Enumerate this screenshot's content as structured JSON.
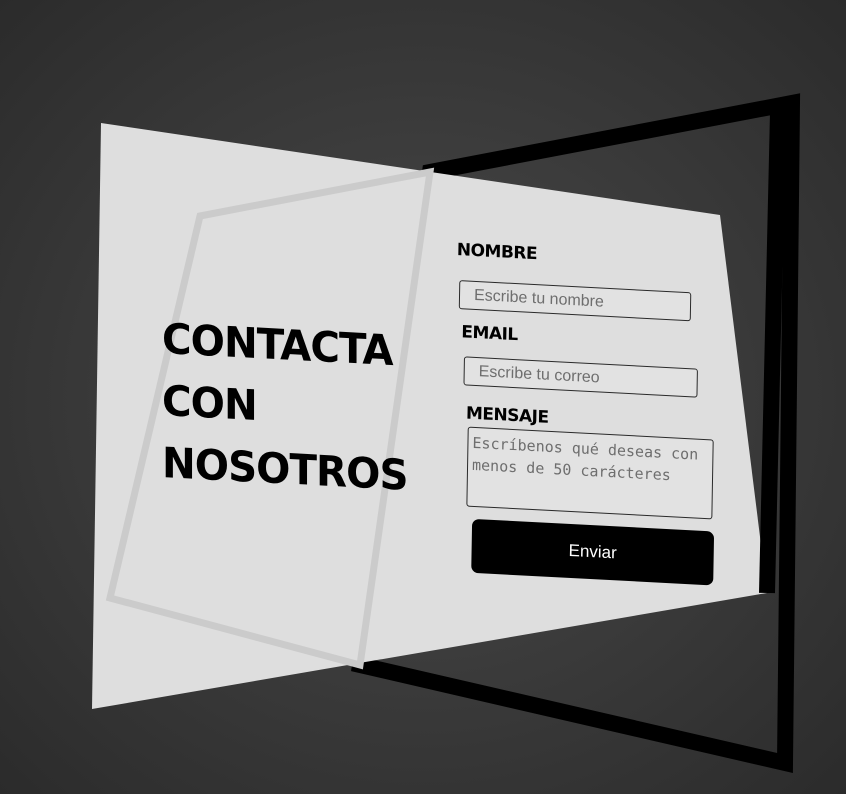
{
  "contact": {
    "heading": "CONTACTA\nCON\nNOSOTROS"
  },
  "form": {
    "name": {
      "label": "NOMBRE",
      "placeholder": "Escribe tu nombre"
    },
    "email": {
      "label": "EMAIL",
      "placeholder": "Escribe tu correo"
    },
    "message": {
      "label": "MENSAJE",
      "placeholder": "Escríbenos qué deseas con menos de 50 carácteres"
    },
    "submit_label": "Enviar"
  },
  "colors": {
    "background": "#3c3c3c",
    "card": "#dedede",
    "frame": "#000000",
    "button": "#000000",
    "button_text": "#ffffff"
  }
}
